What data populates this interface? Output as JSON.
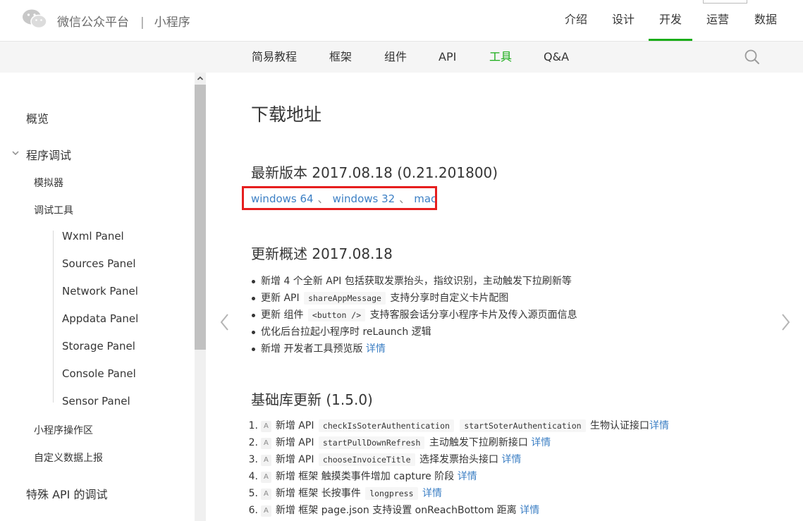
{
  "header": {
    "brand_name": "微信公众平台",
    "brand_sep": "|",
    "brand_sub": "小程序",
    "nav": [
      {
        "label": "介绍",
        "active": false
      },
      {
        "label": "设计",
        "active": false
      },
      {
        "label": "开发",
        "active": true
      },
      {
        "label": "运营",
        "active": false
      },
      {
        "label": "数据",
        "active": false
      }
    ]
  },
  "subnav": {
    "items": [
      {
        "label": "简易教程",
        "active": false
      },
      {
        "label": "框架",
        "active": false
      },
      {
        "label": "组件",
        "active": false
      },
      {
        "label": "API",
        "active": false
      },
      {
        "label": "工具",
        "active": true
      },
      {
        "label": "Q&A",
        "active": false
      }
    ],
    "search_icon": "search-icon"
  },
  "sidebar": {
    "items": [
      {
        "label": "概览",
        "level": 1
      },
      {
        "label": "程序调试",
        "level": 1,
        "expanded": true
      },
      {
        "label": "模拟器",
        "level": 2
      },
      {
        "label": "调试工具",
        "level": 2
      },
      {
        "label": "Wxml Panel",
        "level": 3
      },
      {
        "label": "Sources Panel",
        "level": 3
      },
      {
        "label": "Network Panel",
        "level": 3
      },
      {
        "label": "Appdata Panel",
        "level": 3
      },
      {
        "label": "Storage Panel",
        "level": 3
      },
      {
        "label": "Console Panel",
        "level": 3
      },
      {
        "label": "Sensor Panel",
        "level": 3
      },
      {
        "label": "小程序操作区",
        "level": 2
      },
      {
        "label": "自定义数据上报",
        "level": 2
      },
      {
        "label": "特殊 API 的调试",
        "level": 1
      }
    ]
  },
  "content": {
    "title": "下载地址",
    "latest_heading": "最新版本 2017.08.18 (0.21.201800)",
    "downloads": [
      "windows 64",
      "windows 32",
      "mac"
    ],
    "download_sep": "、",
    "overview_heading": "更新概述 2017.08.18",
    "overview": [
      {
        "text": "新增 4 个全新 API 包括获取发票抬头，指纹识别，主动触发下拉刷新等"
      },
      {
        "pre": "更新 API",
        "code": "shareAppMessage",
        "post": "支持分享时自定义卡片配图"
      },
      {
        "pre": "更新 组件",
        "code": "<button />",
        "post": "支持客服会话分享小程序卡片及传入源页面信息"
      },
      {
        "text": "优化后台拉起小程序时 reLaunch 逻辑"
      },
      {
        "pre": "新增 开发者工具预览版",
        "link": "详情"
      }
    ],
    "lib_heading": "基础库更新 (1.5.0)",
    "lib_tag": "A",
    "lib_updates": [
      {
        "num": "1.",
        "pre": "新增 API",
        "codes": [
          "checkIsSoterAuthentication",
          "startSoterAuthentication"
        ],
        "post": "生物认证接口",
        "link": "详情"
      },
      {
        "num": "2.",
        "pre": "新增 API",
        "codes": [
          "startPullDownRefresh"
        ],
        "post": "主动触发下拉刷新接口",
        "link": "详情"
      },
      {
        "num": "3.",
        "pre": "新增 API",
        "codes": [
          "chooseInvoiceTitle"
        ],
        "post": "选择发票抬头接口",
        "link": "详情"
      },
      {
        "num": "4.",
        "pre": "新增 框架 触摸类事件增加 capture 阶段",
        "codes": [],
        "post": "",
        "link": "详情"
      },
      {
        "num": "5.",
        "pre": "新增 框架 长按事件",
        "codes": [
          "longpress"
        ],
        "post": "",
        "link": "详情"
      },
      {
        "num": "6.",
        "pre": "新增 框架 page.json 支持设置 onReachBottom 距离",
        "codes": [],
        "post": "",
        "link": "详情"
      }
    ]
  },
  "colors": {
    "accent_green": "#1aad19",
    "link_blue": "#3c7fc4",
    "highlight_red": "#e61e1e"
  }
}
